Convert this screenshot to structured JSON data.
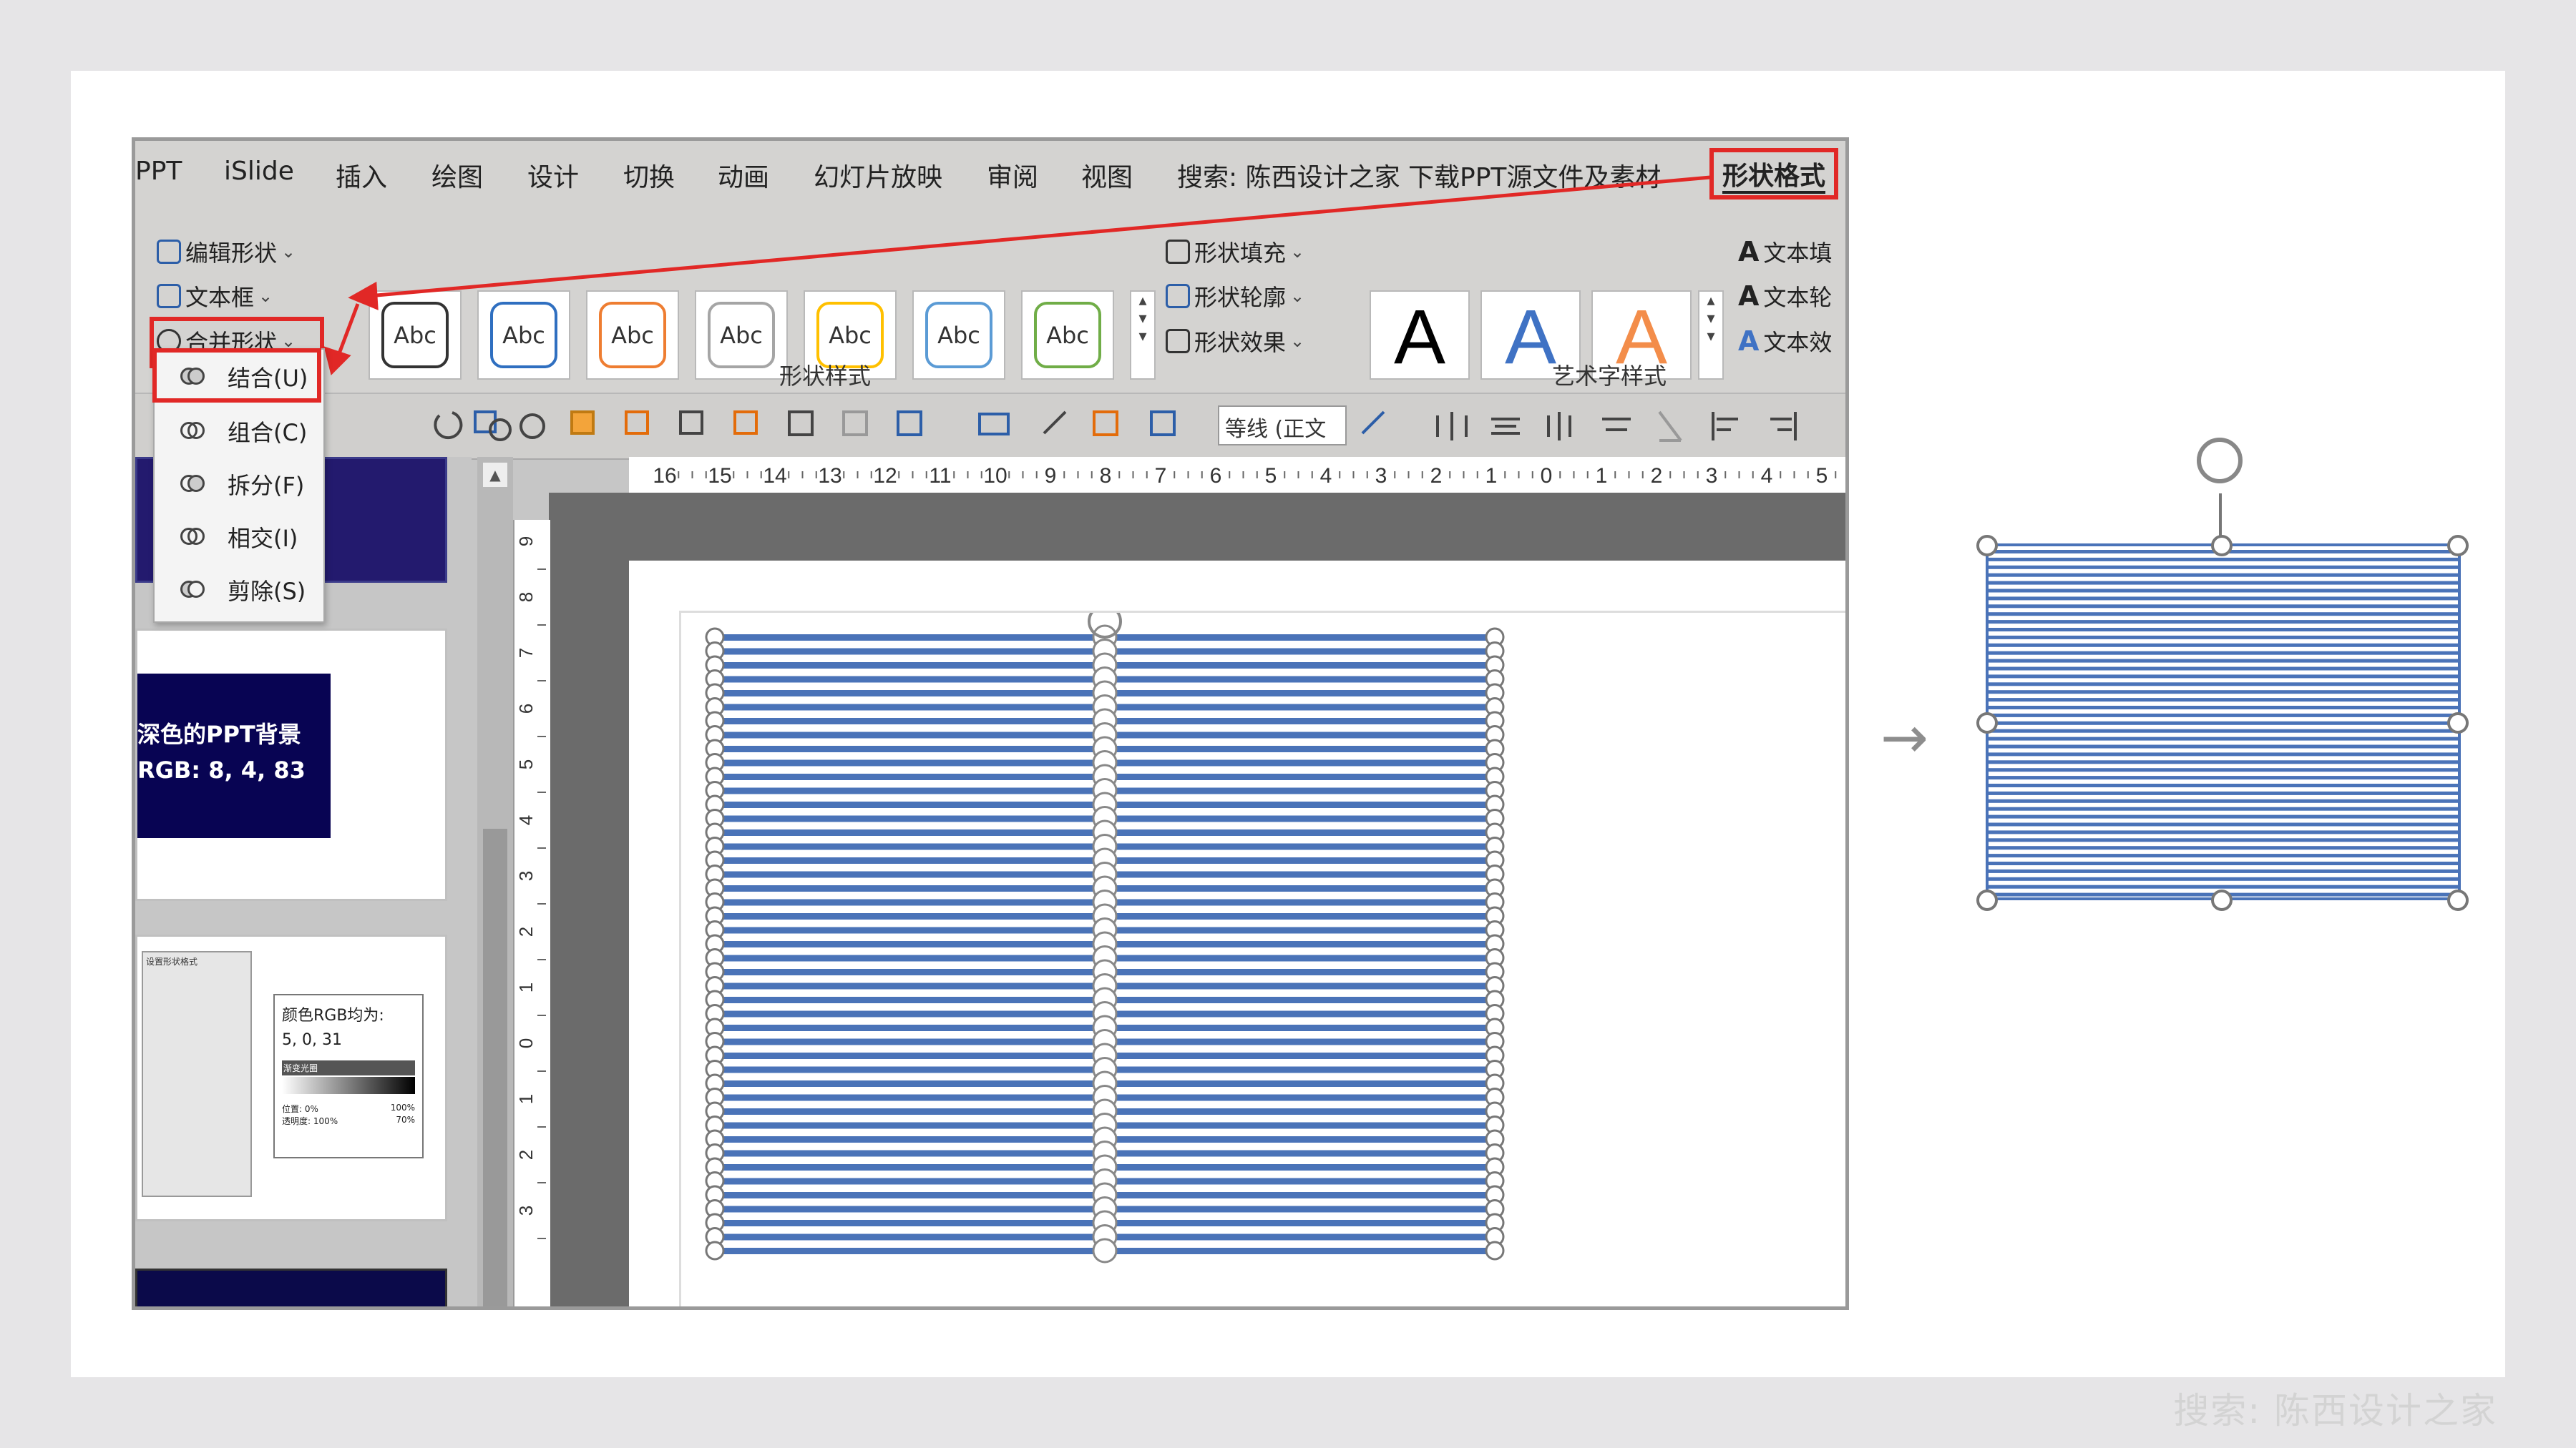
{
  "menu": {
    "items": [
      "PPT",
      "iSlide",
      "插入",
      "绘图",
      "设计",
      "切换",
      "动画",
      "幻灯片放映",
      "审阅",
      "视图"
    ],
    "search": "搜索: 陈西设计之家  下载PPT源文件及素材",
    "active_tab": "形状格式"
  },
  "ribbon": {
    "insert_group": {
      "edit_shape": "编辑形状",
      "textbox": "文本框",
      "merge_shapes": "合并形状"
    },
    "shape_styles": {
      "thumb_label": "Abc",
      "thumb_colors": [
        "#333333",
        "#2f6fc0",
        "#ee7d31",
        "#a5a5a5",
        "#ffc000",
        "#5b9bd5",
        "#70ad47"
      ],
      "fill": "形状填充",
      "outline": "形状轮廓",
      "effect": "形状效果",
      "group_label": "形状样式"
    },
    "wordart": {
      "letter": "A",
      "group_label": "艺术字样式",
      "text_fill": "文本填",
      "text_outline": "文本轮",
      "text_effect": "文本效"
    },
    "font_select": "等线 (正文"
  },
  "merge_menu": {
    "items": [
      "结合(U)",
      "组合(C)",
      "拆分(F)",
      "相交(I)",
      "剪除(S)"
    ]
  },
  "thumbnails": {
    "slide1_line1": "深色的PPT背景",
    "slide1_line2": "RGB: 8, 4, 83",
    "slide2_title": "颜色RGB均为:",
    "slide2_value": "5, 0, 31",
    "slide2_panel_title": "设置形状格式",
    "slide2_gradient_label": "渐变光圈",
    "slide2_position": "位置: 0%",
    "slide2_position_right": "100%",
    "slide2_transparency": "透明度: 100%",
    "slide2_transparency_right": "70%"
  },
  "rulers": {
    "horizontal": [
      "16",
      "15",
      "14",
      "13",
      "12",
      "11",
      "10",
      "9",
      "8",
      "7",
      "6",
      "5",
      "4",
      "3",
      "2",
      "1",
      "0",
      "1",
      "2",
      "3",
      "4",
      "5"
    ],
    "vertical": [
      "9",
      "8",
      "7",
      "6",
      "5",
      "4",
      "3",
      "2",
      "1",
      "0",
      "1",
      "2",
      "3"
    ]
  },
  "watermark": "搜索: 陈西设计之家",
  "colors": {
    "highlight": "#e12826",
    "stripe": "#4a73b8",
    "dark_slide": "#080453"
  }
}
